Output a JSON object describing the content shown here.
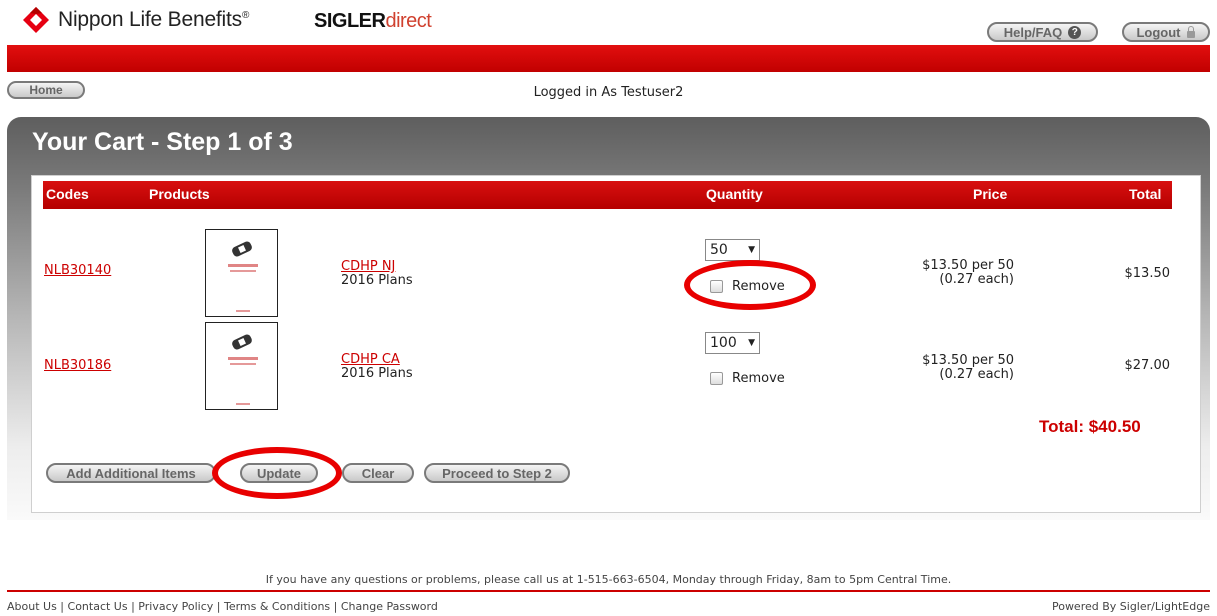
{
  "header": {
    "brand_name": "Nippon Life Benefits",
    "brand_mark": "®",
    "partner_bold": "SIGLER",
    "partner_light": "direct",
    "help_label": "Help/FAQ",
    "help_icon": "question-icon",
    "logout_label": "Logout",
    "logout_icon": "lock-icon"
  },
  "nav": {
    "home_label": "Home",
    "logged_in_text": "Logged in As Testuser2"
  },
  "cart": {
    "title": "Your Cart - Step 1 of 3",
    "columns": {
      "codes": "Codes",
      "products": "Products",
      "quantity": "Quantity",
      "price": "Price",
      "total": "Total"
    },
    "items": [
      {
        "code": "NLB30140",
        "product_name": "CDHP NJ",
        "product_sub": "2016 Plans",
        "quantity": "50",
        "remove_label": "Remove",
        "price_line1": "$13.50 per 50",
        "price_line2": "(0.27 each)",
        "total": "$13.50"
      },
      {
        "code": "NLB30186",
        "product_name": "CDHP CA",
        "product_sub": "2016 Plans",
        "quantity": "100",
        "remove_label": "Remove",
        "price_line1": "$13.50 per 50",
        "price_line2": "(0.27 each)",
        "total": "$27.00"
      }
    ],
    "grand_total": "Total: $40.50",
    "buttons": {
      "add": "Add Additional Items",
      "update": "Update",
      "clear": "Clear",
      "proceed": "Proceed to Step 2"
    }
  },
  "footer": {
    "message": "If you have any questions or problems, please call us at 1-515-663-6504, Monday through Friday, 8am to 5pm Central Time.",
    "links": [
      "About Us",
      "Contact Us",
      "Privacy Policy",
      "Terms & Conditions",
      "Change Password"
    ],
    "powered": "Powered By Sigler/LightEdge"
  },
  "colors": {
    "brand_red": "#c10000",
    "annotation_red": "#e80000",
    "link_red": "#cc0000"
  }
}
